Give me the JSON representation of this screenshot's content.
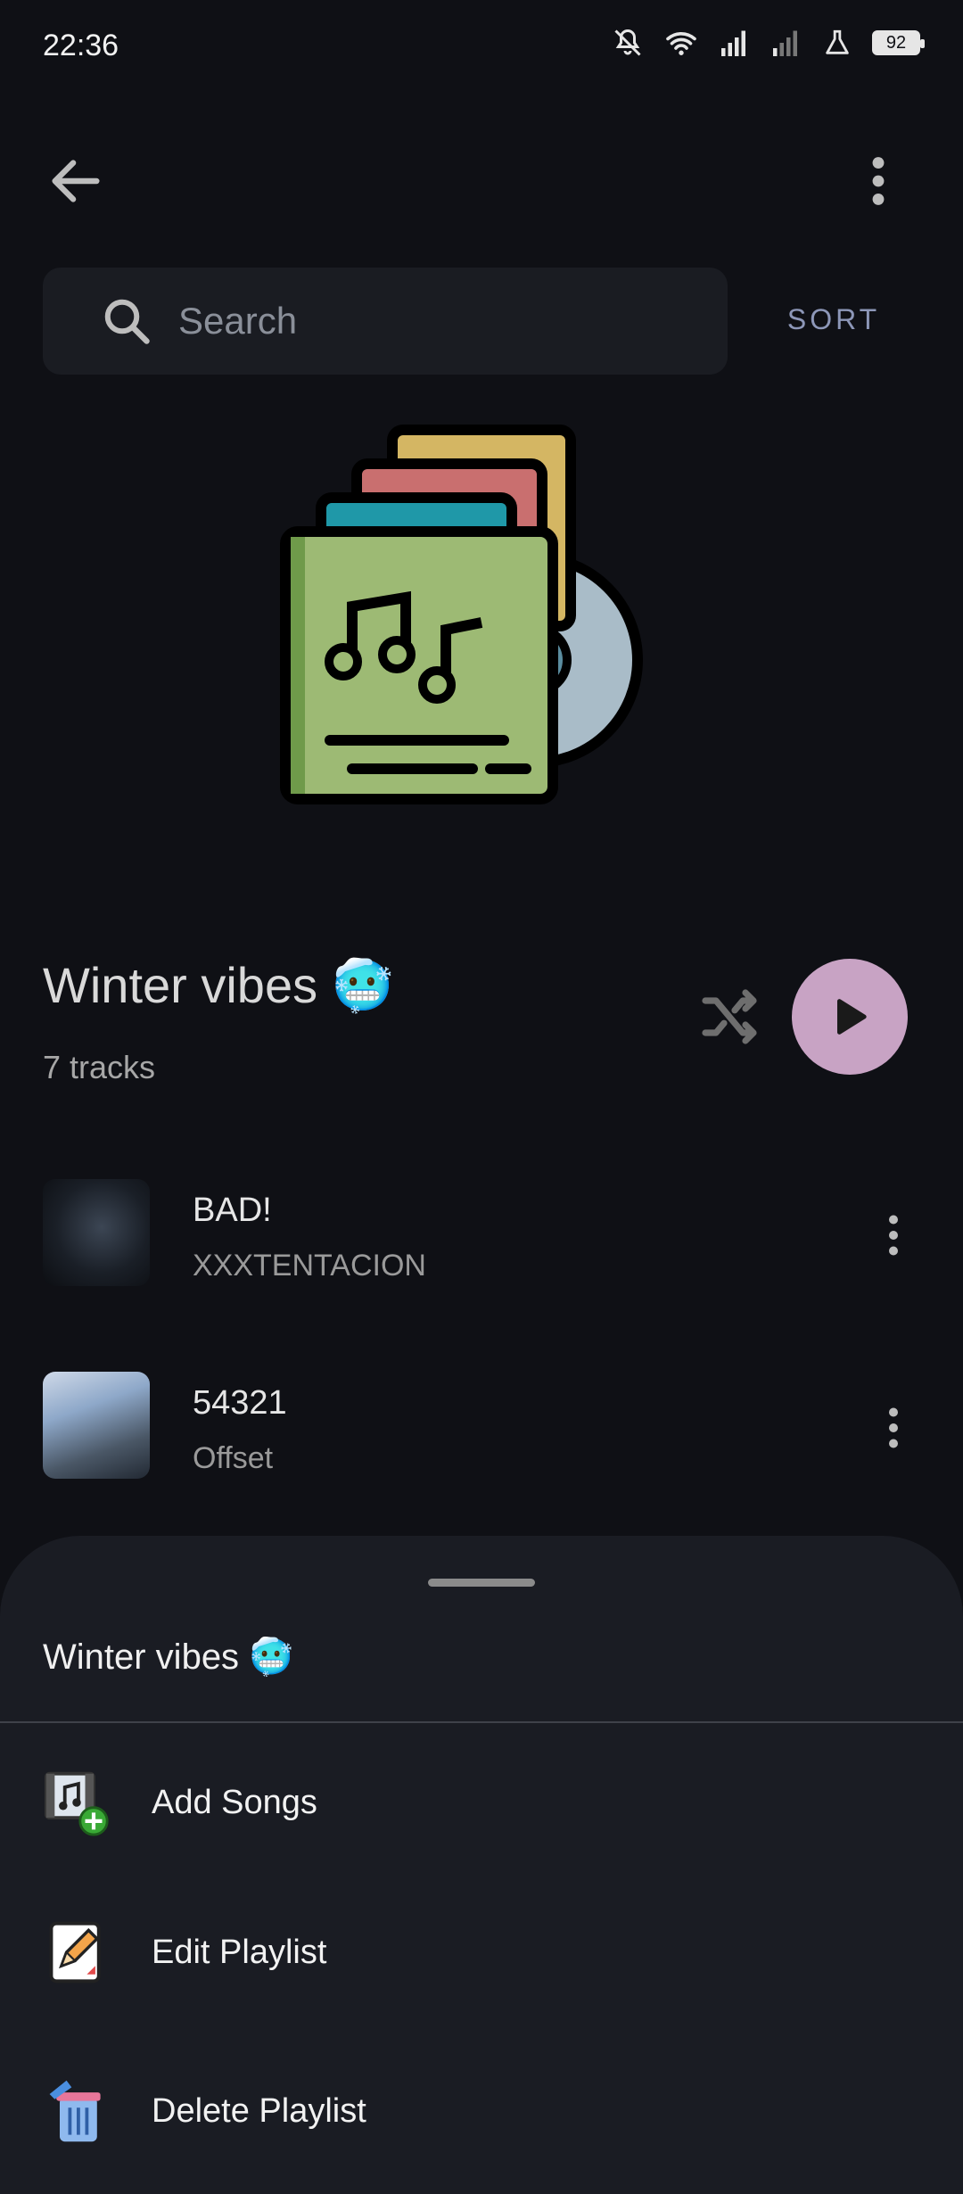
{
  "status_bar": {
    "time": "22:36",
    "battery": "92"
  },
  "search": {
    "placeholder": "Search"
  },
  "sort_label": "SORT",
  "playlist": {
    "title": "Winter vibes 🥶",
    "tracks_count": "7 tracks"
  },
  "tracks": [
    {
      "title": "BAD!",
      "artist": "XXXTENTACION"
    },
    {
      "title": "54321",
      "artist": "Offset"
    }
  ],
  "sheet": {
    "title": "Winter vibes 🥶",
    "items": [
      {
        "label": "Add Songs",
        "icon": "add-songs-icon"
      },
      {
        "label": "Edit Playlist",
        "icon": "edit-playlist-icon"
      },
      {
        "label": "Delete Playlist",
        "icon": "delete-playlist-icon"
      }
    ]
  },
  "colors": {
    "background": "#0f1015",
    "play_button": "#c8a3c4",
    "sheet": "#1a1c23",
    "sort": "#8d97b8"
  }
}
